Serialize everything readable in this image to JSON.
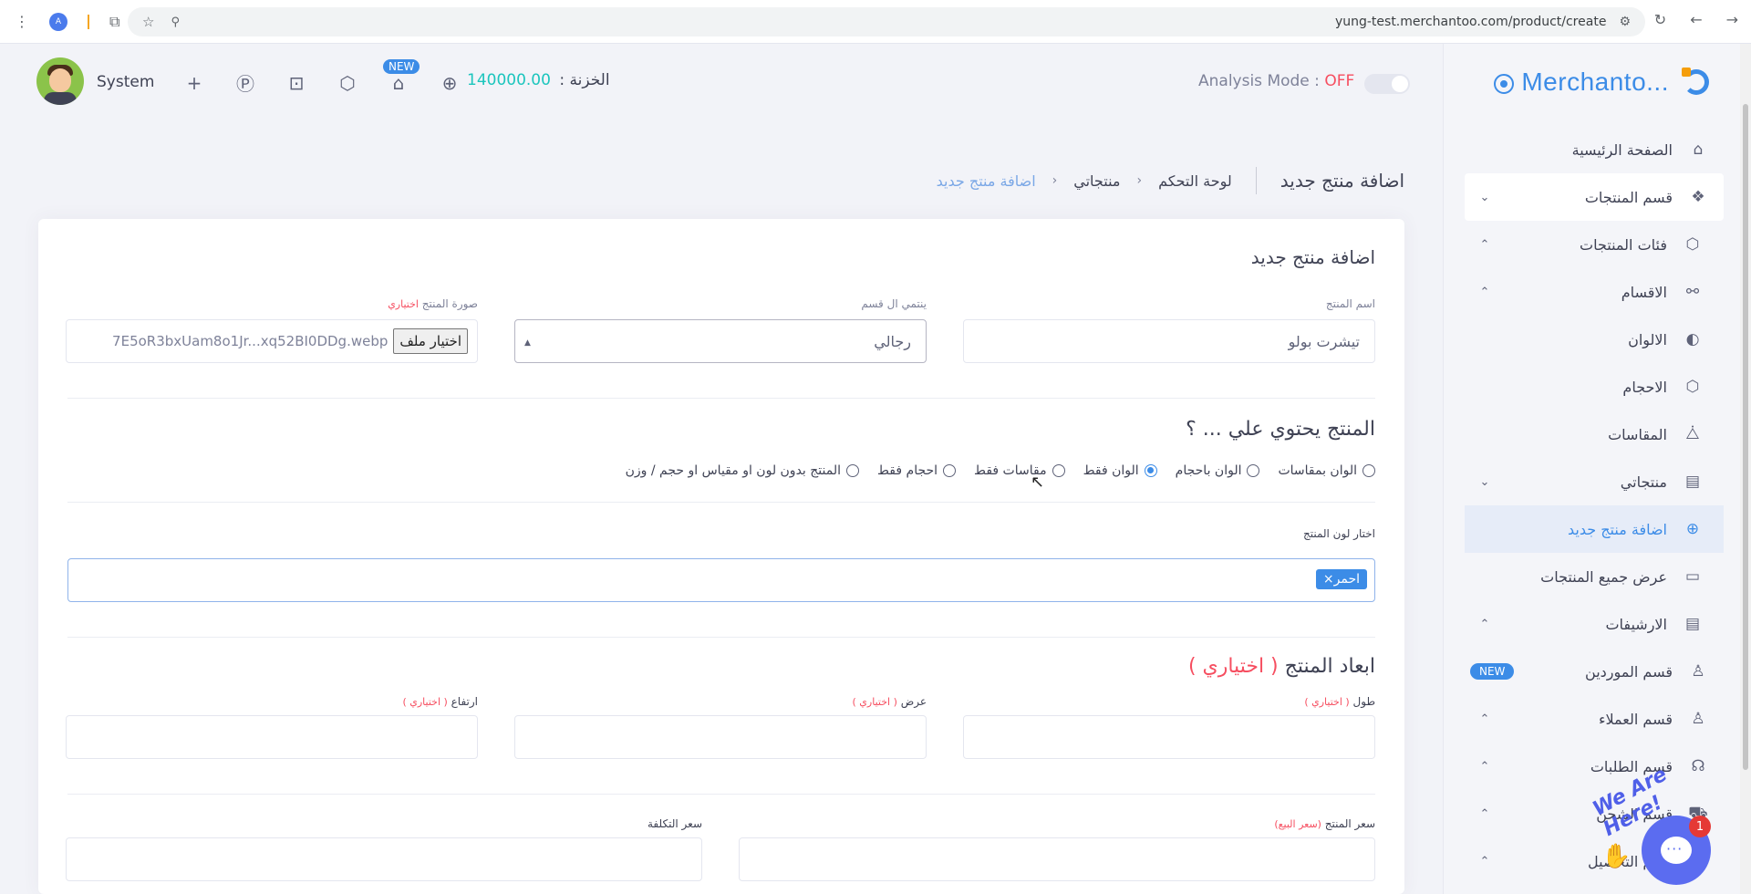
{
  "browser": {
    "url": "yung-test.merchantoo.com/product/create",
    "ext_label": "A"
  },
  "brand": {
    "name": "Merchanto..."
  },
  "sidebar": {
    "items": [
      {
        "label": "الصفحة الرئيسية",
        "icon": "⌂"
      },
      {
        "label": "قسم المنتجات",
        "icon": "❖",
        "chevron": "⌄"
      },
      {
        "label": "فئات المنتجات",
        "icon": "⬡",
        "chevron": "⌃"
      },
      {
        "label": "الاقسام",
        "icon": "⚯",
        "chevron": "⌃"
      },
      {
        "label": "الالوان",
        "icon": "◐"
      },
      {
        "label": "الاحجام",
        "icon": "⬡"
      },
      {
        "label": "المقاسات",
        "icon": "⧊"
      },
      {
        "label": "منتجاتي",
        "icon": "▤",
        "chevron": "⌄"
      },
      {
        "label": "اضافة منتج جديد",
        "icon": "⊕"
      },
      {
        "label": "عرض جميع المنتجات",
        "icon": "▭"
      },
      {
        "label": "الارشيفات",
        "icon": "▤",
        "chevron": "⌃"
      },
      {
        "label": "قسم الموردين",
        "icon": "♙",
        "badge": "NEW"
      },
      {
        "label": "قسم العملاء",
        "icon": "♙",
        "chevron": "⌃"
      },
      {
        "label": "قسم الطلبات",
        "icon": "☊",
        "chevron": "⌃"
      },
      {
        "label": "قسم الشحن",
        "icon": "⛟",
        "chevron": "⌃"
      },
      {
        "label": "قسم التحصيل",
        "icon": "$",
        "chevron": "⌃"
      }
    ]
  },
  "topbar": {
    "user_name": "System",
    "new_badge": "NEW",
    "treasury_label": "الخزنة :",
    "treasury_value": "140000.00",
    "analysis_label": "Analysis Mode :",
    "analysis_state": "OFF"
  },
  "breadcrumb": {
    "title": "اضافة منتج جديد",
    "items": [
      "لوحة التحكم",
      "منتجاتي",
      "اضافة منتج جديد"
    ]
  },
  "form": {
    "card_title": "اضافة منتج جديد",
    "name_label": "اسم المنتج",
    "name_value": "تيشرت بولو",
    "category_label": "ينتمي ال قسم",
    "category_value": "رجالي",
    "image_label": "صورة المنتج",
    "optional": "اختياري",
    "file_button": "اختيار ملف",
    "file_name": "7E5oR3bxUam8o1Jr...xq52BI0DDg.webp",
    "contains_title": "المنتج يحتوي علي ... ؟",
    "radio_options": [
      "الوان بمقاسات",
      "الوان باحجام",
      "الوان فقط",
      "مقاسات فقط",
      "احجام فقط",
      "المنتج بدون لون او مقياس او حجم / وزن"
    ],
    "selected_radio_index": 2,
    "color_label": "اختار لون المنتج",
    "color_tag": "احمر×",
    "dimensions_title": "ابعاد المنتج",
    "dimensions_optional": "( اختياري )",
    "length_label": "طول",
    "width_label": "عرض",
    "height_label": "ارتفاع",
    "optional_paren": "( اختياري )",
    "price_label": "سعر المنتج",
    "price_note": "(سعر البيع)",
    "cost_label": "سعر التكلفة"
  },
  "chat": {
    "caption": "We Are Here!",
    "badge_count": "1"
  },
  "colors": {
    "accent": "#3c8ce7",
    "danger": "#f64e60",
    "success": "#1bc5bd"
  }
}
